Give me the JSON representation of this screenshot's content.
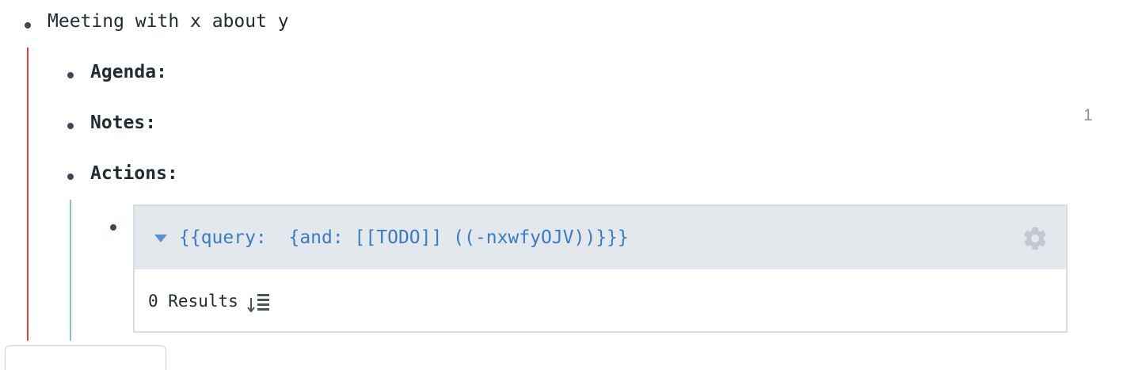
{
  "block": {
    "title": "Meeting with x about y",
    "children": [
      {
        "label": "Agenda:"
      },
      {
        "label": "Notes:"
      },
      {
        "label": "Actions:"
      }
    ],
    "reference_count": "1"
  },
  "query": {
    "text": "{{query:  {and: [[TODO]] ((-nxwfyOJV))}}}",
    "results_label": "0 Results",
    "icons": {
      "collapse": "caret-down-icon",
      "settings": "gear-icon",
      "sort": "sort-icon"
    }
  },
  "colors": {
    "left_guide": "#d0463b",
    "nested_guide": "#7cc8c8",
    "query_text": "#3a7bc8",
    "query_header_bg": "#e3e8ec"
  }
}
